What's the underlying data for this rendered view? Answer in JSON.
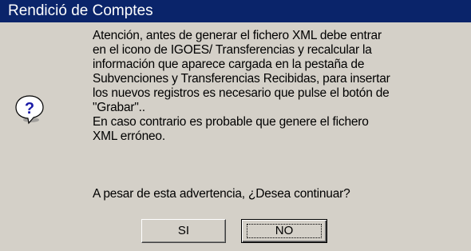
{
  "window": {
    "title": "Rendició de Comptes"
  },
  "icon": {
    "name": "question-icon",
    "glyph": "?",
    "color": "#1a1aa6"
  },
  "message": {
    "lines": [
      "Atención, antes de generar el fichero XML debe entrar",
      "en el icono de IGOES/ Transferencias y recalcular la",
      "información que aparece cargada en la pestaña de",
      "Subvenciones y Transferencias Recibidas, para insertar",
      "los nuevos registros es necesario que pulse el botón de",
      "\"Grabar\"..",
      "En caso contrario es probable que genere el fichero",
      "XML erróneo."
    ],
    "question": "A pesar de esta advertencia, ¿Desea continuar?"
  },
  "buttons": {
    "yes_label": "SI",
    "no_label": "NO"
  },
  "colors": {
    "titlebar": "#0a246a",
    "face": "#d4d0c8"
  }
}
